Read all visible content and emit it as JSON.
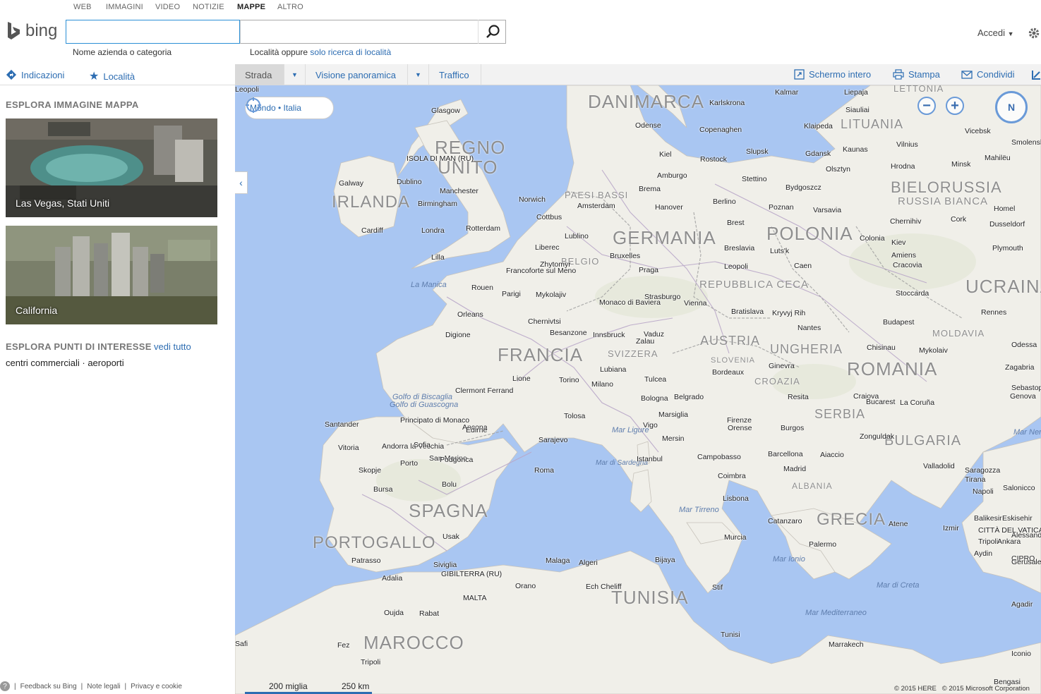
{
  "topnav": {
    "items": [
      "WEB",
      "IMMAGINI",
      "VIDEO",
      "NOTIZIE",
      "MAPPE",
      "ALTRO"
    ],
    "active": "MAPPE"
  },
  "brand": {
    "name": "bing"
  },
  "search": {
    "what_value": "",
    "where_value": "",
    "what_hint": "Nome azienda o categoria",
    "where_hint_prefix": "Località oppure",
    "where_hint_link": "solo ricerca di località"
  },
  "account": {
    "signin": "Accedi"
  },
  "sidebar": {
    "directions": "Indicazioni",
    "places": "Località",
    "explore_images_title": "ESPLORA IMMAGINE MAPPA",
    "tiles": [
      {
        "caption": "Las Vegas, Stati Uniti"
      },
      {
        "caption": "California"
      }
    ],
    "poi_title": "ESPLORA PUNTI DI INTERESSE",
    "poi_see_all": "vedi tutto",
    "poi_items": [
      "centri commerciali",
      "aeroporti"
    ],
    "footer": {
      "feedback": "Feedback su Bing",
      "legal": "Note legali",
      "privacy": "Privacy e cookie"
    }
  },
  "toolbar": {
    "road": "Strada",
    "birdseye": "Visione panoramica",
    "traffic": "Traffico",
    "fullscreen": "Schermo intero",
    "print": "Stampa",
    "share": "Condividi"
  },
  "map": {
    "location_pill": "Mondo • Italia",
    "compass": "N",
    "countries": [
      {
        "t": "DANIMARCA"
      },
      {
        "t": "REGNO"
      },
      {
        "t": "UNITO"
      },
      {
        "t": "IRLANDA"
      },
      {
        "t": "GERMANIA"
      },
      {
        "t": "POLONIA"
      },
      {
        "t": "PAESI BASSI"
      },
      {
        "t": "BELGIO"
      },
      {
        "t": "FRANCIA"
      },
      {
        "t": "SVIZZERA"
      },
      {
        "t": "AUSTRIA"
      },
      {
        "t": "REPUBBLICA CECA"
      },
      {
        "t": "UNGHERIA"
      },
      {
        "t": "ROMANIA"
      },
      {
        "t": "UCRAINA"
      },
      {
        "t": "BIELORUSSIA"
      },
      {
        "t": "RUSSIA BIANCA"
      },
      {
        "t": "LITUANIA"
      },
      {
        "t": "LETTONIA"
      },
      {
        "t": "MOLDAVIA"
      },
      {
        "t": "SLOVENIA"
      },
      {
        "t": "CROAZIA"
      },
      {
        "t": "SERBIA"
      },
      {
        "t": "BULGARIA"
      },
      {
        "t": "SPAGNA"
      },
      {
        "t": "PORTOGALLO"
      },
      {
        "t": "MAROCCO"
      },
      {
        "t": "TUNISIA"
      },
      {
        "t": "GRECIA"
      },
      {
        "t": "ALBANIA"
      }
    ],
    "cities": [
      "Kalmar",
      "Liepaja",
      "Karlskrona",
      "Glasgow",
      "Odense",
      "Copenaghen",
      "Siauliai",
      "Klaipeda",
      "Vicebsk",
      "Smolensk",
      "ISOLA DI MAN (RU)",
      "Kiel",
      "Slupsk",
      "Gdansk",
      "Kaunas",
      "Vilnius",
      "Galway",
      "Dublino",
      "Amburgo",
      "Rostock",
      "Olsztyn",
      "Hrodna",
      "Minsk",
      "Mahilëu",
      "Manchester",
      "Brema",
      "Stettino",
      "Bydgoszcz",
      "Norwich",
      "Birmingham",
      "Berlino",
      "Hanover",
      "Amsterdam",
      "Poznan",
      "Varsavia",
      "Homel",
      "Cork",
      "Cardiff",
      "Londra",
      "Rotterdam",
      "Cottbus",
      "Brest",
      "Chernihiv",
      "Dusseldorf",
      "Lublino",
      "Colonia",
      "Bruxelles",
      "Liberec",
      "Breslavia",
      "Luts'k",
      "Kiev",
      "Plymouth",
      "Lilla",
      "Zhytomyr",
      "Amiens",
      "Francoforte sul Meno",
      "Praga",
      "Leopoli",
      "Cracovia",
      "Caen",
      "Rouen",
      "Parigi",
      "Mykolajiv",
      "Stoccarda",
      "Strasburgo",
      "Monaco di Baviera",
      "Vienna",
      "Bratislava",
      "Kryvyj Rih",
      "Rennes",
      "Orleans",
      "Chernivtsi",
      "Budapest",
      "Nantes",
      "Digione",
      "Besanzone",
      "Innsbruck",
      "Vaduz",
      "Zalau",
      "Chisinau",
      "Mykolaiv",
      "Odessa",
      "Zagabria",
      "Ginevra",
      "Lubiana",
      "Bordeaux",
      "Clermont Ferrand",
      "Lione",
      "Torino",
      "Milano",
      "Tulcea",
      "Sebastopoli",
      "Genova",
      "Bologna",
      "Belgrado",
      "Resita",
      "Craiova",
      "Bucarest",
      "La Coruña",
      "Santander",
      "Principato di Monaco",
      "San Marino",
      "Tolosa",
      "Marsiglia",
      "Firenze",
      "Ancona",
      "Sarajevo",
      "Vigo",
      "Orense",
      "Burgos",
      "Vitoria",
      "Andorra la Vecchia",
      "Sofia",
      "Edirne",
      "Zonguldak",
      "Valladolid",
      "Saragozza",
      "Porto",
      "Podgorica",
      "Skopje",
      "Barcellona",
      "Aiaccio",
      "Roma",
      "Istanbul",
      "Campobasso",
      "Tirana",
      "Coimbra",
      "Madrid",
      "Bursa",
      "Bolu",
      "Napoli",
      "Salonicco",
      "Lisbona",
      "Balikesir",
      "Eskisehir",
      "Catanzaro",
      "Atene",
      "Izmir",
      "Usak",
      "Murcia",
      "Palermo",
      "Patrasso",
      "Siviglia",
      "Malaga",
      "Algeri",
      "Bijaya",
      "Tunisi",
      "Tripoli",
      "Aydin",
      "Adalia",
      "GIBILTERRA (RU)",
      "Orano",
      "Ech Cheliff",
      "Stif",
      "MALTA",
      "Oujda",
      "Rabat",
      "Fez",
      "Tripoli",
      "Bengasi",
      "Safi",
      "Marrakech",
      "Agadir",
      "Alessandria",
      "Ankara",
      "CIPRO",
      "Iconio",
      "Gerusalemme",
      "Mersin",
      "CITTÀ DEL VATICANO",
      "Leopoli"
    ],
    "seas": [
      "La Manica",
      "Golfo di Biscaglia",
      "Golfo di Guascogna",
      "Mar Ligure",
      "Mar di Sardegna",
      "Mar Tirreno",
      "Mar Ionio",
      "Mar di Creta",
      "Mar Mediterraneo",
      "Mar Nero"
    ],
    "scale": {
      "miles": "200 miglia",
      "km": "250 km"
    },
    "copyright": {
      "here": "© 2015 HERE",
      "ms": "© 2015 Microsoft Corporation"
    }
  },
  "colors": {
    "accent": "#2d6db2",
    "sea": "#a9c6f2",
    "land": "#f0efe9"
  }
}
